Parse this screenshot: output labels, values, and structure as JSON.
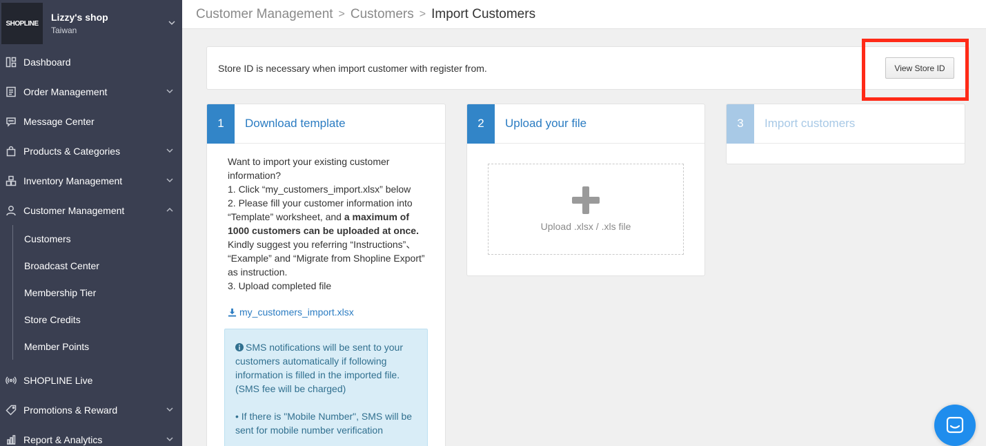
{
  "sidebar": {
    "shop_name": "Lizzy's shop",
    "shop_region": "Taiwan",
    "logo_text": "SHOPLINE",
    "items": [
      {
        "label": "Dashboard"
      },
      {
        "label": "Order Management"
      },
      {
        "label": "Message Center"
      },
      {
        "label": "Products & Categories"
      },
      {
        "label": "Inventory Management"
      },
      {
        "label": "Customer Management"
      }
    ],
    "sub_items": [
      {
        "label": "Customers"
      },
      {
        "label": "Broadcast Center"
      },
      {
        "label": "Membership Tier"
      },
      {
        "label": "Store Credits"
      },
      {
        "label": "Member Points"
      }
    ],
    "bottom_items": [
      {
        "label": "SHOPLINE Live"
      },
      {
        "label": "Promotions & Reward"
      },
      {
        "label": "Report & Analytics"
      }
    ]
  },
  "breadcrumb": {
    "level1": "Customer Management",
    "level2": "Customers",
    "current": "Import Customers",
    "separator": ">"
  },
  "notice": {
    "text": "Store ID is necessary when import customer with register from.",
    "button_label": "View Store ID"
  },
  "steps": [
    {
      "number": "1",
      "title": "Download template"
    },
    {
      "number": "2",
      "title": "Upload your file"
    },
    {
      "number": "3",
      "title": "Import customers"
    }
  ],
  "template": {
    "intro": "Want to import your existing customer information?",
    "step1": "1. Click “my_customers_import.xlsx” below",
    "step2_pre": "2. Please fill your customer information into “Template” worksheet, and ",
    "step2_bold": "a maximum of 1000 customers can be uploaded at once.",
    "step2_post": " Kindly suggest you referring “Instructions”、 “Example” and “Migrate from Shopline Export” as instruction.",
    "step3": "3. Upload completed file",
    "download_link": "my_customers_import.xlsx",
    "sms_notice": "SMS notifications will be sent to your customers automatically if following information is filled in the imported file. (SMS fee will be charged)",
    "sms_bullet": "• If there is \"Mobile Number\", SMS will be sent for mobile number verification"
  },
  "upload": {
    "dropzone_text": "Upload .xlsx / .xls file"
  },
  "colors": {
    "sidebar_bg": "#3a3f51",
    "accent_blue": "#3285c8",
    "highlight_red": "#ff2a17",
    "chat_blue": "#1f8ded"
  }
}
